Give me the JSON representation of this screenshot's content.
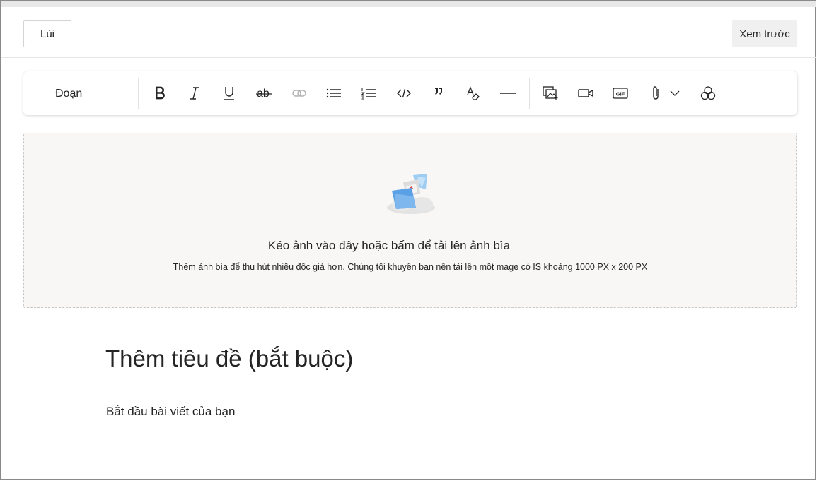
{
  "header": {
    "back_label": "Lùi",
    "preview_label": "Xem trước"
  },
  "toolbar": {
    "paragraph_style": "Đoạn",
    "buttons": [
      {
        "name": "bold-icon"
      },
      {
        "name": "italic-icon"
      },
      {
        "name": "underline-icon"
      },
      {
        "name": "strikethrough-icon"
      },
      {
        "name": "link-icon"
      },
      {
        "name": "bulleted-list-icon"
      },
      {
        "name": "numbered-list-icon"
      },
      {
        "name": "code-icon"
      },
      {
        "name": "quote-icon"
      },
      {
        "name": "clear-formatting-icon"
      },
      {
        "name": "horizontal-rule-icon"
      },
      {
        "name": "image-icon"
      },
      {
        "name": "video-icon"
      },
      {
        "name": "gif-icon"
      },
      {
        "name": "attachment-icon"
      },
      {
        "name": "chevron-down-icon"
      },
      {
        "name": "shapes-icon"
      }
    ],
    "gif_text": "GIF"
  },
  "cover": {
    "title": "Kéo ảnh vào đây hoặc bấm để tải lên ảnh bìa",
    "subtitle": "Thêm ảnh bìa để thu hút nhiều độc giả hơn. Chúng tôi khuyên bạn nên tải lên một mage có IS khoảng 1000 PX x 200 PX"
  },
  "editor": {
    "title_placeholder": "Thêm tiêu đề (bắt buộc)",
    "body_placeholder": "Bắt đầu bài viết của bạn"
  },
  "colors": {
    "accent_red": "#e23b3b",
    "illustration_blue": "#5aa0e6",
    "cover_bg": "#f8f7f6"
  }
}
